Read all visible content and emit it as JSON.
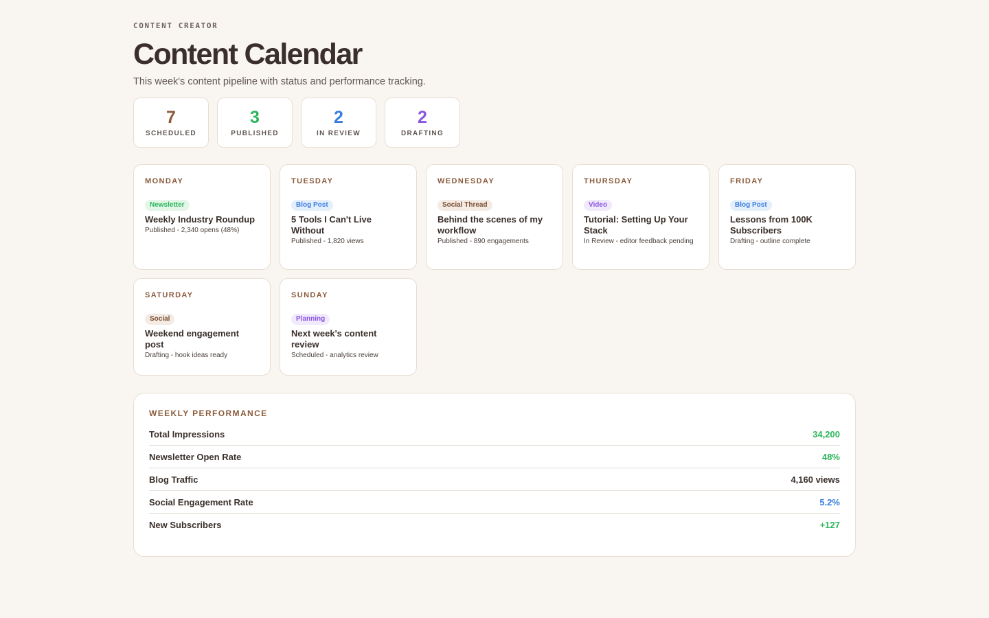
{
  "header": {
    "eyebrow": "CONTENT CREATOR",
    "title": "Content Calendar",
    "subtitle": "This week's content pipeline with status and performance tracking."
  },
  "stats": [
    {
      "value": "7",
      "label": "SCHEDULED",
      "color": "#8a5a3b"
    },
    {
      "value": "3",
      "label": "PUBLISHED",
      "color": "#2cb65c"
    },
    {
      "value": "2",
      "label": "IN REVIEW",
      "color": "#3b7ddd"
    },
    {
      "value": "2",
      "label": "DRAFTING",
      "color": "#8b55e0"
    }
  ],
  "days": [
    {
      "day": "MONDAY",
      "tag": "Newsletter",
      "tag_bg": "#e3f6e8",
      "tag_color": "#2cb65c",
      "title": "Weekly Industry Roundup",
      "status": "Published - 2,340 opens (48%)"
    },
    {
      "day": "TUESDAY",
      "tag": "Blog Post",
      "tag_bg": "#e5effc",
      "tag_color": "#3b7ddd",
      "title": "5 Tools I Can't Live Without",
      "status": "Published - 1,820 views"
    },
    {
      "day": "WEDNESDAY",
      "tag": "Social Thread",
      "tag_bg": "#f3ebe4",
      "tag_color": "#7a4f33",
      "title": "Behind the scenes of my workflow",
      "status": "Published - 890 engagements"
    },
    {
      "day": "THURSDAY",
      "tag": "Video",
      "tag_bg": "#f1e9fc",
      "tag_color": "#8b55e0",
      "title": "Tutorial: Setting Up Your Stack",
      "status": "In Review - editor feedback pending"
    },
    {
      "day": "FRIDAY",
      "tag": "Blog Post",
      "tag_bg": "#e5effc",
      "tag_color": "#3b7ddd",
      "title": "Lessons from 100K Subscribers",
      "status": "Drafting - outline complete"
    },
    {
      "day": "SATURDAY",
      "tag": "Social",
      "tag_bg": "#f3ebe4",
      "tag_color": "#7a4f33",
      "title": "Weekend engagement post",
      "status": "Drafting - hook ideas ready"
    },
    {
      "day": "SUNDAY",
      "tag": "Planning",
      "tag_bg": "#f1e9fc",
      "tag_color": "#8b55e0",
      "title": "Next week's content review",
      "status": "Scheduled - analytics review"
    }
  ],
  "performance": {
    "title": "WEEKLY PERFORMANCE",
    "rows": [
      {
        "label": "Total Impressions",
        "value": "34,200",
        "color": "#2cb65c"
      },
      {
        "label": "Newsletter Open Rate",
        "value": "48%",
        "color": "#2cb65c"
      },
      {
        "label": "Blog Traffic",
        "value": "4,160 views",
        "color": "#3a2f2a"
      },
      {
        "label": "Social Engagement Rate",
        "value": "5.2%",
        "color": "#3b7ddd"
      },
      {
        "label": "New Subscribers",
        "value": "+127",
        "color": "#2cb65c"
      }
    ]
  }
}
